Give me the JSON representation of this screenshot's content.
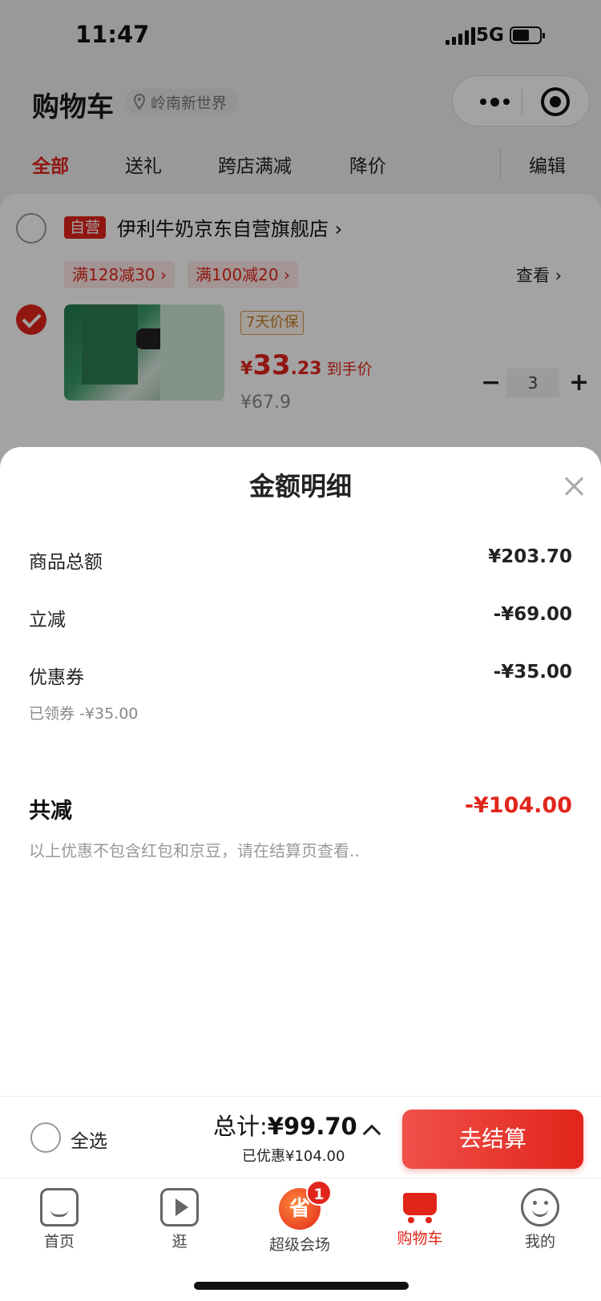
{
  "status": {
    "time": "11:47",
    "network": "5G"
  },
  "header": {
    "title": "购物车",
    "location": "岭南新世界"
  },
  "tabs": [
    {
      "label": "全部"
    },
    {
      "label": "送礼"
    },
    {
      "label": "跨店满减"
    },
    {
      "label": "降价"
    },
    {
      "label": "编辑"
    }
  ],
  "store": {
    "badge": "自营",
    "name": "伊利牛奶京东自营旗舰店 ›",
    "promos": [
      "满128减30 ›",
      "满100减20 ›"
    ],
    "view_more": "查看 ›"
  },
  "product": {
    "guarantee": "7天价保",
    "price_symbol": "¥",
    "price_int": "33",
    "price_dec": ".23",
    "price_tag": "到手价",
    "original_price": "¥67.9",
    "quantity": "3"
  },
  "modal": {
    "title": "金额明细",
    "rows": [
      {
        "label": "商品总额",
        "value": "¥203.70"
      },
      {
        "label": "立减",
        "value": "-¥69.00"
      },
      {
        "label": "优惠券",
        "value": "-¥35.00"
      }
    ],
    "coupon_note": "已领券 -¥35.00",
    "total_label": "共减",
    "total_value": "-¥104.00",
    "disclaimer": "以上优惠不包含红包和京豆，请在结算页查看.."
  },
  "checkout": {
    "select_all": "全选",
    "total_label": "总计:",
    "total_amount": "¥99.70",
    "saved": "已优惠¥104.00",
    "button": "去结算"
  },
  "tabbar": [
    {
      "label": "首页",
      "icon": "home-icon"
    },
    {
      "label": "逛",
      "icon": "video-icon"
    },
    {
      "label": "超级会场",
      "icon": "super-venue-icon",
      "badge": "1"
    },
    {
      "label": "购物车",
      "icon": "cart-icon"
    },
    {
      "label": "我的",
      "icon": "profile-icon"
    }
  ],
  "colors": {
    "accent": "#e1251b",
    "muted": "#999999"
  }
}
